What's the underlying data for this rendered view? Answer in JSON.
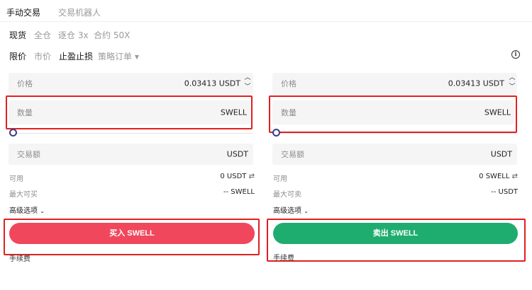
{
  "tabs": [
    {
      "label": "手动交易",
      "active": true
    },
    {
      "label": "交易机器人",
      "active": false
    }
  ],
  "modes": [
    "现货",
    "全仓",
    "逐仓 3x",
    "合约 50X"
  ],
  "order_types": [
    {
      "label": "限价",
      "active": true
    },
    {
      "label": "市价",
      "active": false
    },
    {
      "label": "止盈止损",
      "active": false
    },
    {
      "label": "策略订单",
      "active": false
    }
  ],
  "buy": {
    "price_label": "价格",
    "price_value": "0.03413 USDT",
    "quantity_label": "数量",
    "quantity_unit": "SWELL",
    "slider_fraction": 0,
    "amount_label": "交易额",
    "amount_unit": "USDT",
    "available_label": "可用",
    "available_value": "0 USDT",
    "max_label": "最大可买",
    "max_value": "-- SWELL",
    "advanced_label": "高级选项",
    "button_label": "买入 SWELL",
    "fee_label": "手续费"
  },
  "sell": {
    "price_label": "价格",
    "price_value": "0.03413 USDT",
    "quantity_label": "数量",
    "quantity_unit": "SWELL",
    "slider_fraction": 0,
    "amount_label": "交易额",
    "amount_unit": "USDT",
    "available_label": "可用",
    "available_value": "0 SWELL",
    "max_label": "最大可卖",
    "max_value": "-- USDT",
    "advanced_label": "高级选项",
    "button_label": "卖出 SWELL",
    "fee_label": "手续费"
  },
  "colors": {
    "buy": "#f0475c",
    "sell": "#1fad6f",
    "highlight": "#e02020",
    "field_bg": "#f5f5f5"
  },
  "icons": [
    "caret-down-icon",
    "info-icon",
    "chevron-up-icon",
    "chevron-down-icon",
    "swap-icon"
  ]
}
